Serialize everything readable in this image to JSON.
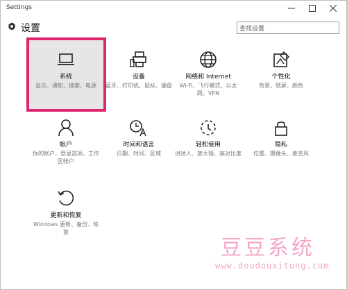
{
  "window": {
    "title": "Settings",
    "controls": [
      "minimize-icon",
      "maximize-icon",
      "close-icon"
    ]
  },
  "header": {
    "icon": "gear-icon",
    "title": "设置",
    "search_placeholder": "查找设置"
  },
  "tiles": [
    {
      "label": "系统",
      "desc": "显示、通知、搜索、电源",
      "icon": "laptop-icon",
      "selected": true
    },
    {
      "label": "设备",
      "desc": "蓝牙、打印机、鼠标、键盘",
      "icon": "devices-icon"
    },
    {
      "label": "网络和 Internet",
      "desc": "Wi-Fi、飞行模式、以太网、VPN",
      "icon": "globe-icon"
    },
    {
      "label": "个性化",
      "desc": "背景、锁屏、颜色",
      "icon": "personalization-icon"
    },
    {
      "label": "帐户",
      "desc": "你的帐户、登录选项、工作区帐户",
      "icon": "person-icon"
    },
    {
      "label": "时间和语言",
      "desc": "日期、时间、区域",
      "icon": "time-language-icon"
    },
    {
      "label": "轻松使用",
      "desc": "讲述人、放大镜、高对比度",
      "icon": "ease-of-access-icon"
    },
    {
      "label": "隐私",
      "desc": "位置、摄像头、麦克风",
      "icon": "lock-icon"
    },
    {
      "label": "更新和恢复",
      "desc": "Windows 更新、备份、恢复",
      "icon": "update-icon"
    }
  ],
  "watermark": {
    "text": "豆豆系统",
    "url": "www.doudouxitong.com"
  },
  "colors": {
    "selection_border": "#e0246e",
    "selection_bg": "#e6e6e6",
    "watermark": "#f3a6c8"
  }
}
